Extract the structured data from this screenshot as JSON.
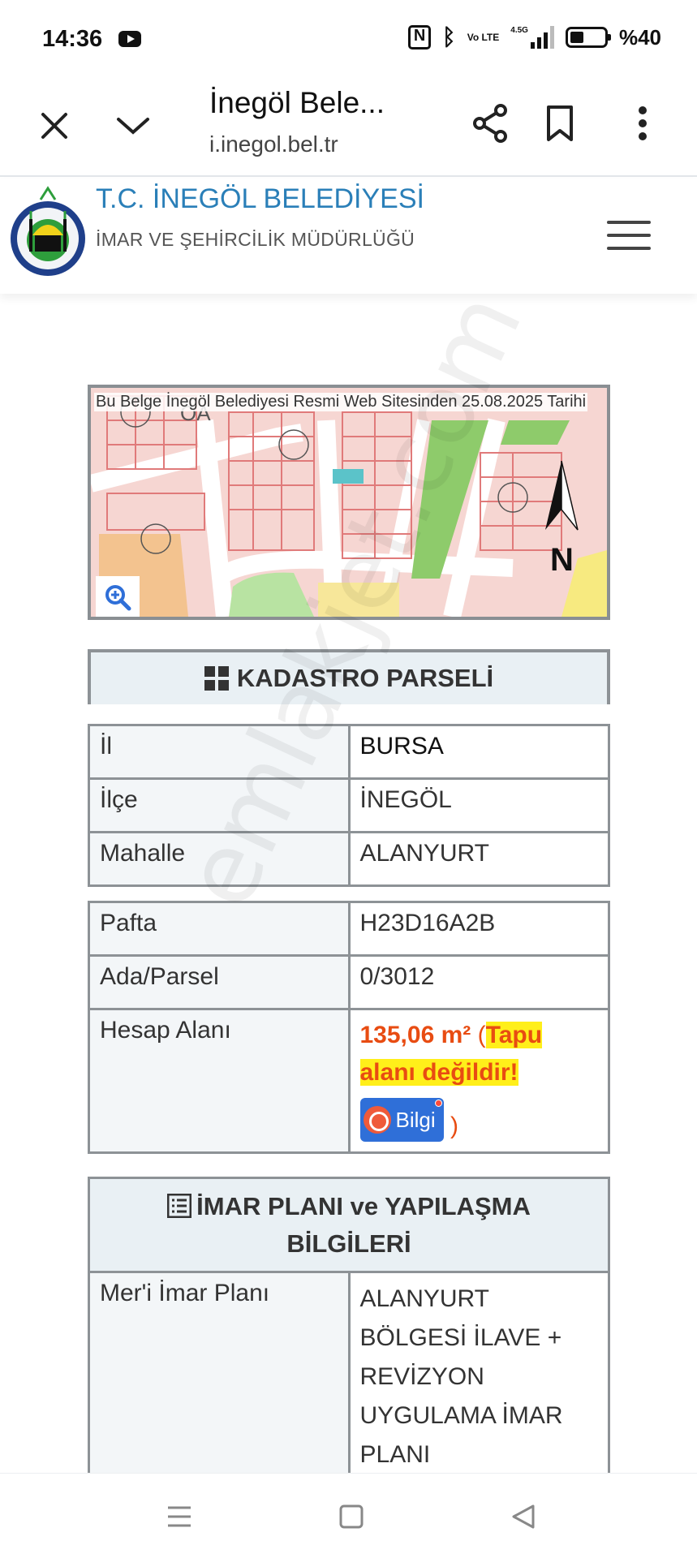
{
  "status_bar": {
    "time": "14:36",
    "battery": "%40",
    "network": "4.5G",
    "volte": "Vo LTE"
  },
  "browser": {
    "tab_title": "İnegöl Bele...",
    "url": "i.inegol.bel.tr"
  },
  "site": {
    "title": "T.C. İNEGÖL BELEDİYESİ",
    "subtitle": "İMAR VE ŞEHİRCİLİK MÜDÜRLÜĞÜ"
  },
  "map": {
    "caption": "Bu Belge İnegöl Belediyesi Resmi Web Sitesinden 25.08.2025 Tarihi",
    "north_label": "N",
    "parcel_label": "ÖA"
  },
  "kadastro": {
    "title": "KADASTRO PARSELİ",
    "location_rows": [
      {
        "label": "İl",
        "value": "BURSA"
      },
      {
        "label": "İlçe",
        "value": "İNEGÖL"
      },
      {
        "label": "Mahalle",
        "value": "ALANYURT"
      }
    ],
    "parcel_rows": [
      {
        "label": "Pafta",
        "value": "H23D16A2B"
      },
      {
        "label": "Ada/Parsel",
        "value": "0/3012"
      }
    ],
    "hesap_alani": {
      "label": "Hesap Alanı",
      "value": "135,06 m²",
      "open_paren": "(",
      "note": "Tapu alanı değildir!",
      "button_label": "Bilgi",
      "close_paren": ")"
    }
  },
  "imar": {
    "title": "İMAR PLANI ve YAPILAŞMA BİLGİLERİ",
    "rows": [
      {
        "label": "Mer'i İmar Planı",
        "value": "ALANYURT BÖLGESİ İLAVE + REVİZYON UYGULAMA İMAR PLANI"
      }
    ]
  },
  "watermark": "emlakjet.com",
  "colors": {
    "accent": "#2a7fb8",
    "area_value": "#e84c12",
    "note_highlight": "#ffef1a",
    "button": "#2f6fd8"
  }
}
